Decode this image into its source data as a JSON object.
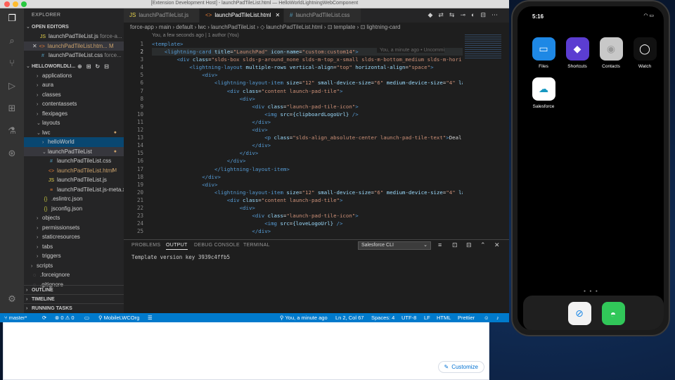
{
  "window": {
    "title": "[Extension Development Host] - launchPadTileList.html — HelloWorldLightningWebComponent"
  },
  "sidebar": {
    "title": "EXPLORER",
    "open_editors_title": "OPEN EDITORS",
    "open_editors": [
      {
        "name": "launchPadTileList.js",
        "extra": "force-a...",
        "icon": "js-icon"
      },
      {
        "name": "launchPadTileList.htm...",
        "extra": "M",
        "icon": "html-icon"
      },
      {
        "name": "launchPadTileList.css",
        "extra": "force...",
        "icon": "css-icon"
      }
    ],
    "project_title": "HELLOWORLDLI...",
    "tree": [
      {
        "label": "applications",
        "indent": 1
      },
      {
        "label": "aura",
        "indent": 1
      },
      {
        "label": "classes",
        "indent": 1
      },
      {
        "label": "contentassets",
        "indent": 1
      },
      {
        "label": "flexipages",
        "indent": 1
      },
      {
        "label": "layouts",
        "indent": 1
      },
      {
        "label": "lwc",
        "indent": 1
      },
      {
        "label": "helloWorld",
        "indent": 2
      },
      {
        "label": "launchPadTileList",
        "indent": 2
      },
      {
        "label": "launchPadTileList.css",
        "indent": 3
      },
      {
        "label": "launchPadTileList.html",
        "indent": 3,
        "mark": "M"
      },
      {
        "label": "launchPadTileList.js",
        "indent": 3
      },
      {
        "label": "launchPadTileList.js-meta.x...",
        "indent": 3
      },
      {
        "label": ".eslintrc.json",
        "indent": 2
      },
      {
        "label": "jsconfig.json",
        "indent": 2
      },
      {
        "label": "objects",
        "indent": 1
      },
      {
        "label": "permissionsets",
        "indent": 1
      },
      {
        "label": "staticresources",
        "indent": 1
      },
      {
        "label": "tabs",
        "indent": 1
      },
      {
        "label": "triggers",
        "indent": 1
      },
      {
        "label": "scripts",
        "indent": 0
      },
      {
        "label": ".forceignore",
        "indent": 0
      },
      {
        "label": ".gitignore",
        "indent": 0
      }
    ],
    "outline_title": "OUTLINE",
    "timeline_title": "TIMELINE",
    "running_tasks_title": "RUNNING TASKS"
  },
  "tabs": [
    {
      "label": "launchPadTileList.js"
    },
    {
      "label": "launchPadTileList.html"
    },
    {
      "label": "launchPadTileList.css"
    }
  ],
  "breadcrumbs": "force-app › main › default › lwc › launchPadTileList › ◇ launchPadTileList.html › ⊡ template › ⊡ lightning-card",
  "blame": "You, a few seconds ago | 1 author (You)",
  "inline_blame": "You, a minute ago • Uncommi",
  "code_lines": [
    [
      "t:<template>"
    ],
    [
      "tx:    ",
      "t:<lightning-card ",
      "a:title",
      "tx:=",
      "s:\"LaunchPad\" ",
      "a:icon-name",
      "tx:=",
      "s:\"custom:custom14\"",
      "t:>"
    ],
    [
      "tx:        ",
      "t:<div ",
      "a:class",
      "tx:=",
      "s:\"slds-box slds-p-around_none slds-m-top_x-small slds-m-bottom_medium slds-m-hori"
    ],
    [
      "tx:            ",
      "t:<lightning-layout ",
      "a:multiple-rows ",
      "a:vertical-align",
      "tx:=",
      "s:\"top\" ",
      "a:horizontal-align",
      "tx:=",
      "s:\"space\"",
      "t:>"
    ],
    [
      "tx:                ",
      "t:<div>"
    ],
    [
      "tx:                    ",
      "t:<lightning-layout-item ",
      "a:size",
      "tx:=",
      "s:\"12\" ",
      "a:small-device-size",
      "tx:=",
      "s:\"6\" ",
      "a:medium-device-size",
      "tx:=",
      "s:\"4\" ",
      "a:la"
    ],
    [
      "tx:                        ",
      "t:<div ",
      "a:class",
      "tx:=",
      "s:\"content launch-pad-tile\"",
      "t:>"
    ],
    [
      "tx:                            ",
      "t:<div>"
    ],
    [
      "tx:                                ",
      "t:<div ",
      "a:class",
      "tx:=",
      "s:\"launch-pad-tile-icon\"",
      "t:>"
    ],
    [
      "tx:                                    ",
      "t:<img ",
      "a:src",
      "tx:=",
      "a:{clipboardLogoUrl} ",
      "t:/>"
    ],
    [
      "tx:                                ",
      "t:</div>"
    ],
    [
      "tx:                                ",
      "t:<div>"
    ],
    [
      "tx:                                    ",
      "t:<p ",
      "a:class",
      "tx:=",
      "s:\"slds-align_absolute-center launch-pad-tile-text\"",
      "t:>",
      "tx:Deal"
    ],
    [
      "tx:                                ",
      "t:</div>"
    ],
    [
      "tx:                            ",
      "t:</div>"
    ],
    [
      "tx:                        ",
      "t:</div>"
    ],
    [
      "tx:                    ",
      "t:</lightning-layout-item>"
    ],
    [
      "tx:                ",
      "t:</div>"
    ],
    [
      "tx:                ",
      "t:<div>"
    ],
    [
      "tx:                    ",
      "t:<lightning-layout-item ",
      "a:size",
      "tx:=",
      "s:\"12\" ",
      "a:small-device-size",
      "tx:=",
      "s:\"6\" ",
      "a:medium-device-size",
      "tx:=",
      "s:\"4\" ",
      "a:la"
    ],
    [
      "tx:                        ",
      "t:<div ",
      "a:class",
      "tx:=",
      "s:\"content launch-pad-tile\"",
      "t:>"
    ],
    [
      "tx:                            ",
      "t:<div>"
    ],
    [
      "tx:                                ",
      "t:<div ",
      "a:class",
      "tx:=",
      "s:\"launch-pad-tile-icon\"",
      "t:>"
    ],
    [
      "tx:                                    ",
      "t:<img ",
      "a:src",
      "tx:=",
      "a:{loveLogoUrl} ",
      "t:/>"
    ],
    [
      "tx:                                ",
      "t:</div>"
    ]
  ],
  "panel": {
    "tabs": [
      "PROBLEMS",
      "OUTPUT",
      "DEBUG CONSOLE",
      "TERMINAL"
    ],
    "active_tab": "OUTPUT",
    "channel": "Salesforce CLI",
    "output": "Template version key 3939c4ffb5"
  },
  "statusbar": {
    "branch": "master*",
    "problems": "⊗ 0 ⚠ 0",
    "org": "MobileLWCOrg",
    "blame": "You, a minute ago",
    "position": "Ln 2, Col 67",
    "spaces": "Spaces: 4",
    "encoding": "UTF-8",
    "eol": "LF",
    "language": "HTML",
    "formatter": "Prettier"
  },
  "browser": {
    "customize_label": "Customize"
  },
  "simulator": {
    "time": "5:16",
    "apps": [
      {
        "label": "Files",
        "color": "#1e88e5",
        "icon": "files-icon"
      },
      {
        "label": "Shortcuts",
        "color": "#5b3dd1",
        "icon": "shortcuts-icon"
      },
      {
        "label": "Contacts",
        "color": "#c8c8c8",
        "icon": "contacts-icon"
      },
      {
        "label": "Watch",
        "color": "#111111",
        "icon": "watch-icon"
      },
      {
        "label": "Salesforce",
        "color": "#ffffff",
        "icon": "salesforce-icon"
      }
    ],
    "dock": [
      {
        "label": "Safari",
        "color": "#f2f2f2",
        "icon": "safari-icon"
      },
      {
        "label": "Messages",
        "color": "#31c759",
        "icon": "messages-icon"
      }
    ]
  },
  "colors": {
    "accent": "#007acc",
    "statusbar": "#007acc",
    "modified": "#c9a06b"
  }
}
